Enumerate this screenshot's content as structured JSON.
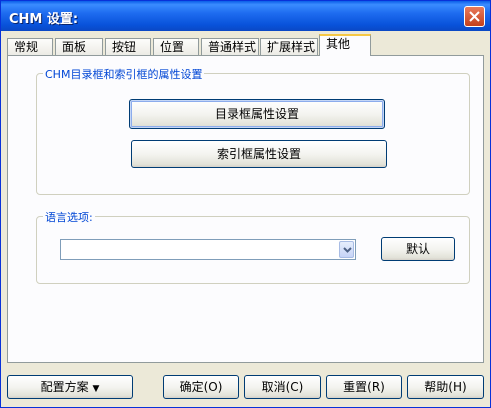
{
  "window": {
    "title": "CHM 设置:"
  },
  "tabs": [
    {
      "label": "常规"
    },
    {
      "label": "面板"
    },
    {
      "label": "按钮"
    },
    {
      "label": "位置"
    },
    {
      "label": "普通样式"
    },
    {
      "label": "扩展样式"
    },
    {
      "label": "其他"
    }
  ],
  "active_tab": "其他",
  "chm_group": {
    "title": "CHM目录框和索引框的属性设置",
    "toc_button": "目录框属性设置",
    "index_button": "索引框属性设置"
  },
  "language_group": {
    "title": "语言选项:",
    "selected_value": "",
    "default_button": "默认"
  },
  "footer": {
    "config_button": "配置方案",
    "ok_button": "确定(O)",
    "cancel_button": "取消(C)",
    "reset_button": "重置(R)",
    "help_button": "帮助(H)"
  },
  "colors": {
    "title_bar": "#0a5ee8",
    "group_label": "#0046d5",
    "dialog_bg": "#ece9d8"
  },
  "icons": {
    "close": "close-icon",
    "dropdown": "chevron-down-icon",
    "config_arrow": "triangle-down-icon"
  }
}
